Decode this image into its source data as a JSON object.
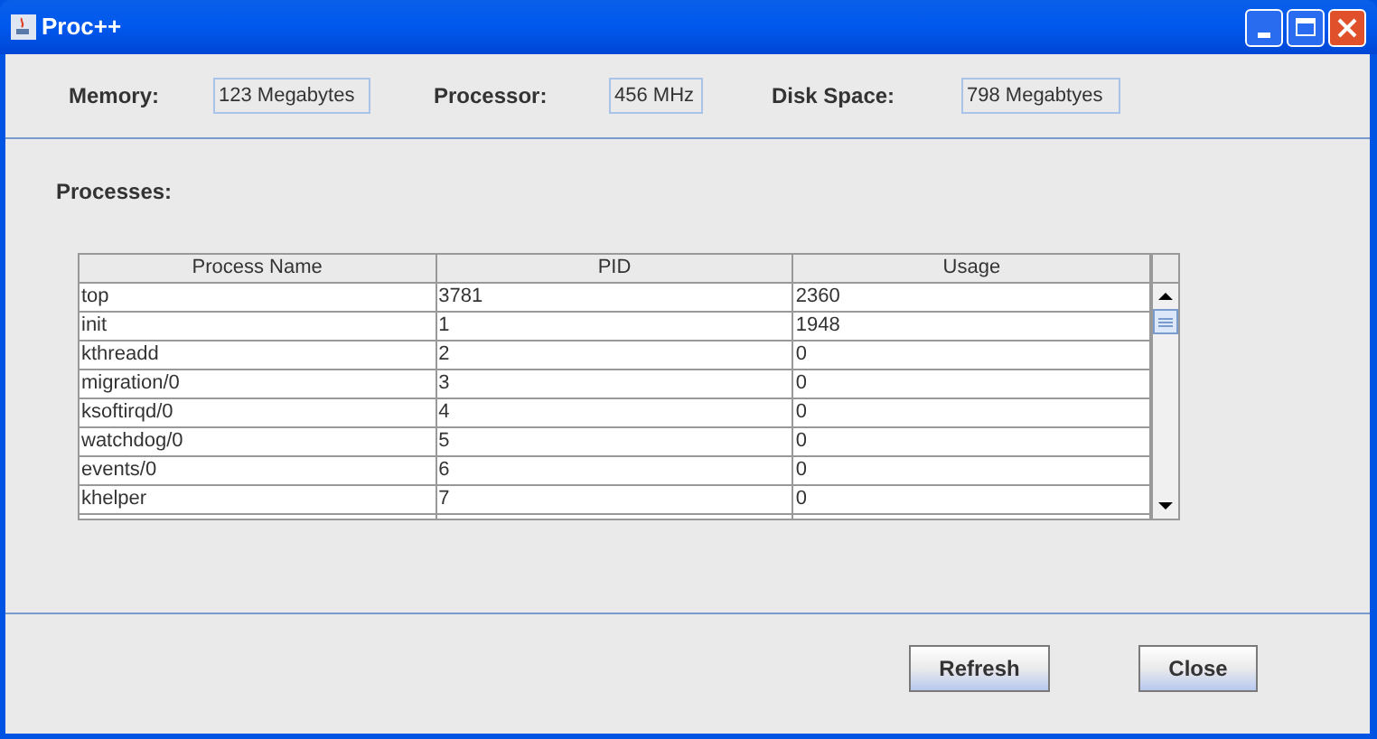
{
  "window": {
    "title": "Proc++"
  },
  "stats": [
    {
      "label": "Memory:",
      "value": "123 Megabytes"
    },
    {
      "label": "Processor:",
      "value": "456 MHz"
    },
    {
      "label": "Disk Space:",
      "value": "798 Megabtyes"
    }
  ],
  "processes_label": "Processes:",
  "table": {
    "columns": [
      "Process Name",
      "PID",
      "Usage"
    ],
    "rows": [
      [
        "top",
        "3781",
        "2360"
      ],
      [
        "init",
        "1",
        "1948"
      ],
      [
        "kthreadd",
        "2",
        "0"
      ],
      [
        "migration/0",
        "3",
        "0"
      ],
      [
        "ksoftirqd/0",
        "4",
        "0"
      ],
      [
        "watchdog/0",
        "5",
        "0"
      ],
      [
        "events/0",
        "6",
        "0"
      ],
      [
        "khelper",
        "7",
        "0"
      ]
    ]
  },
  "buttons": [
    "Refresh",
    "Close"
  ]
}
